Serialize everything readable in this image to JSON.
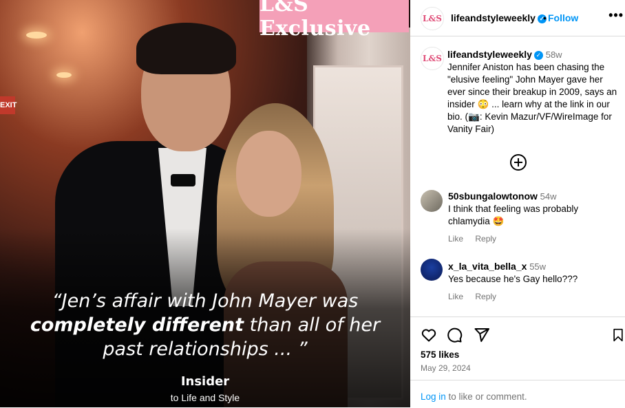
{
  "post": {
    "badge": "L&S Exclusive",
    "quote_line1": "“Jen’s affair with John Mayer was",
    "quote_bold": "completely different",
    "quote_line2_rest": " than all of her",
    "quote_line3": "past relationships ... ”",
    "credit_title": "Insider",
    "credit_sub": "to Life and Style",
    "exit_sign": "EXIT"
  },
  "header": {
    "avatar_text": "L&S",
    "username": "lifeandstyleweekly",
    "dot": "•",
    "follow_label": "Follow",
    "more_label": "•••"
  },
  "caption": {
    "avatar_text": "L&S",
    "username": "lifeandstyleweekly",
    "time": "58w",
    "text": "Jennifer Aniston has been chasing the \"elusive feeling\" John Mayer gave her ever since their breakup in 2009, says an insider 😳 ... learn why at the link in our bio. (📷: Kevin Mazur/VF/WireImage for Vanity Fair)"
  },
  "comments": [
    {
      "username": "50sbungalowtonow",
      "time": "54w",
      "text": "I think that feeling was probably chlamydia 🤩",
      "like": "Like",
      "reply": "Reply"
    },
    {
      "username": "x_la_vita_bella_x",
      "time": "55w",
      "text": "Yes because he's Gay hello???",
      "like": "Like",
      "reply": "Reply"
    }
  ],
  "footer": {
    "likes": "575 likes",
    "date": "May 29, 2024",
    "login_link": "Log in",
    "login_rest": " to like or comment."
  },
  "icons": {
    "like": "heart-icon",
    "comment": "comment-icon",
    "share": "share-icon",
    "save": "bookmark-icon",
    "more": "more-options-icon",
    "add_comment": "plus-circle-icon"
  },
  "colors": {
    "accent": "#0095f6",
    "badge_bg": "#f4a0b8",
    "meta": "#737373"
  }
}
